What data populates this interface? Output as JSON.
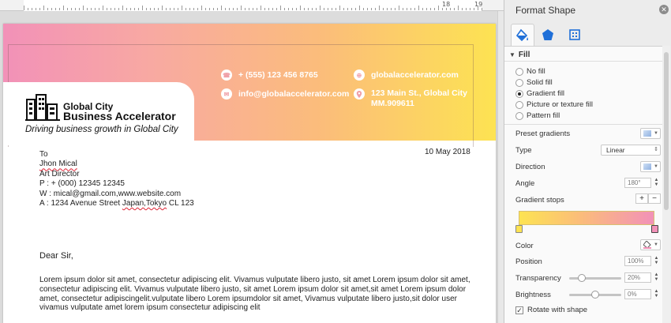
{
  "ruler": {
    "numbers": [
      "18",
      "19"
    ]
  },
  "document": {
    "contacts": [
      {
        "icon": "phone-icon",
        "glyph": "☎",
        "text": "+ (555) 123 456 8765"
      },
      {
        "icon": "globe-icon",
        "glyph": "⊕",
        "text": "globalaccelerator.com"
      },
      {
        "icon": "mail-icon",
        "glyph": "✉",
        "text": "info@globalaccelerator.com"
      },
      {
        "icon": "location-icon",
        "glyph": "⬤",
        "text_line1": "123 Main St., Global City",
        "text_line2": "MM.909611"
      }
    ],
    "logo_line1": "Global City",
    "logo_line2": "Business Accelerator",
    "tagline": "Driving business growth in Global City",
    "date": "10 May 2018",
    "recipient": {
      "to": "To",
      "name": "Jhon Mical",
      "role": "Art Director",
      "phone": "P : + (000) 12345 12345",
      "web": "W : mical@gmail.com,www.website.com",
      "address_prefix": "A : 1234 Avenue Street ",
      "address_place": "Japan,Tokyo",
      "address_suffix": " CL 123"
    },
    "greeting": "Dear Sir,",
    "body_lines": [
      "Lorem ipsum dolor sit amet, consectetur adipiscing elit. Vivamus vulputate libero justo, sit amet Lorem ipsum dolor sit amet,",
      "consectetur adipiscing elit. Vivamus vulputate libero justo, sit amet Lorem ipsum dolor sit amet,sit amet Lorem ipsum dolor",
      "amet, consectetur adipiscingelit.vulputate libero Lorem ipsumdolor sit amet, Vivamus vulputate libero justo,sit dolor user",
      "vivamus vulputate amet lorem ipsum consectetur adipiscing elit"
    ]
  },
  "panel": {
    "title": "Format Shape",
    "tabs": [
      {
        "name": "fill-line-tab",
        "icon": "paint-bucket-icon"
      },
      {
        "name": "effects-tab",
        "icon": "pentagon-icon"
      },
      {
        "name": "size-properties-tab",
        "icon": "size-properties-icon"
      }
    ],
    "accent_color": "#1f6fd8",
    "section_fill": "Fill",
    "fill_options": [
      {
        "label": "No fill",
        "selected": false
      },
      {
        "label": "Solid fill",
        "selected": false
      },
      {
        "label": "Gradient fill",
        "selected": true
      },
      {
        "label": "Picture or texture fill",
        "selected": false
      },
      {
        "label": "Pattern fill",
        "selected": false
      }
    ],
    "preset_gradients_label": "Preset gradients",
    "type_label": "Type",
    "type_value": "Linear",
    "direction_label": "Direction",
    "angle_label": "Angle",
    "angle_value": "180°",
    "gradient_stops_label": "Gradient stops",
    "plus_label": "+",
    "minus_label": "−",
    "color_label": "Color",
    "position_label": "Position",
    "position_value": "100%",
    "transparency_label": "Transparency",
    "transparency_value": "20%",
    "transparency_level": 0.2,
    "brightness_label": "Brightness",
    "brightness_value": "0%",
    "brightness_level": 0.5,
    "rotate_label": "Rotate with shape",
    "rotate_checked": true,
    "gradient_colors": [
      "#fde352",
      "#fbbd7a",
      "#f291b8"
    ]
  }
}
